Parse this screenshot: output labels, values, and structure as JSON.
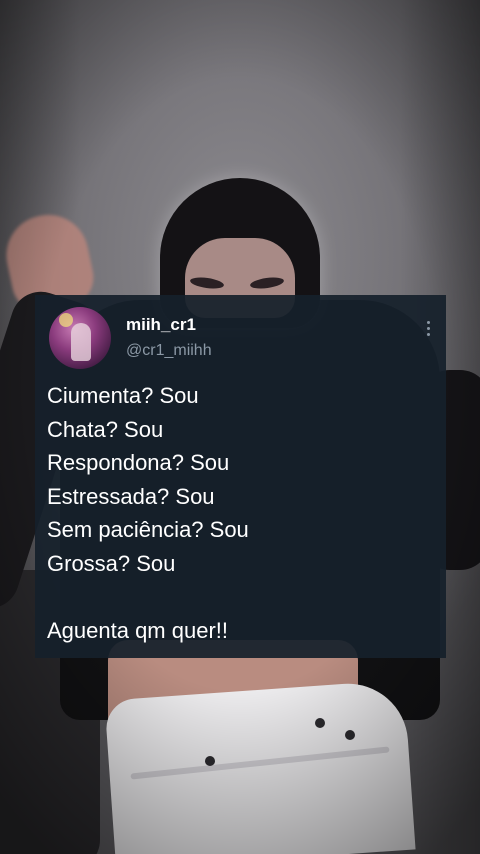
{
  "tweet": {
    "display_name": "miih_cr1",
    "handle": "@cr1_miihh",
    "more_icon": "more-vertical-icon",
    "lines": [
      "Ciumenta? Sou",
      "Chata? Sou",
      "Respondona? Sou",
      "Estressada? Sou",
      "Sem paciência? Sou",
      "Grossa? Sou",
      "",
      "Aguenta qm quer!!"
    ]
  },
  "colors": {
    "card_background": "#15202b",
    "primary_text": "#ffffff",
    "secondary_text": "#8b98a5"
  }
}
